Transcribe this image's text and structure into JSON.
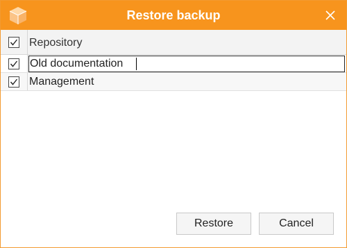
{
  "window": {
    "title": "Restore backup",
    "accent_color": "#f7941d",
    "app_icon": "package-cube-icon",
    "close_icon": "close-icon"
  },
  "table": {
    "header": {
      "checked": true,
      "column_label": "Repository"
    },
    "rows": [
      {
        "checked": true,
        "name": "Old documentation",
        "editing": true
      },
      {
        "checked": true,
        "name": "Management",
        "editing": false
      }
    ]
  },
  "buttons": {
    "restore_label": "Restore",
    "cancel_label": "Cancel"
  }
}
